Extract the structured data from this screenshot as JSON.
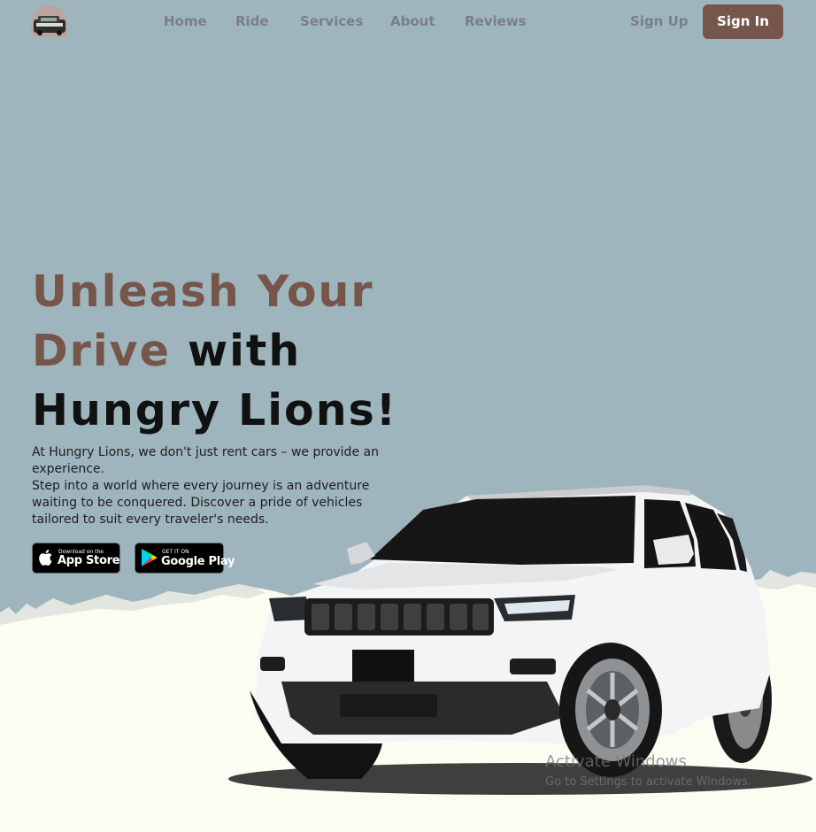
{
  "nav": {
    "links": [
      "Home",
      "Ride",
      "Services",
      "About",
      "Reviews"
    ],
    "signup_label": "Sign Up",
    "signin_label": "Sign In"
  },
  "hero": {
    "headline_line1": "Unleash Your",
    "headline_line2_accent": "Drive",
    "headline_line2_rest": " with",
    "headline_line3": "Hungry Lions!",
    "description_line1": "At Hungry Lions, we don't just rent cars – we provide an experience.",
    "description_line2": "Step into a world where every journey is an adventure waiting to be conquered. Discover a pride of vehicles tailored to suit every traveler's needs."
  },
  "badges": {
    "appstore_small": "Download on the",
    "appstore_big": "App Store",
    "googleplay_small": "GET IT ON",
    "googleplay_big": "Google Play"
  },
  "watermark": {
    "title": "Activate Windows",
    "subtitle": "Go to Settings to activate Windows."
  },
  "colors": {
    "sky": "#9fb5bd",
    "cream": "#fbfcf2",
    "accent": "#76554a",
    "nav_text": "#7a7f84"
  }
}
